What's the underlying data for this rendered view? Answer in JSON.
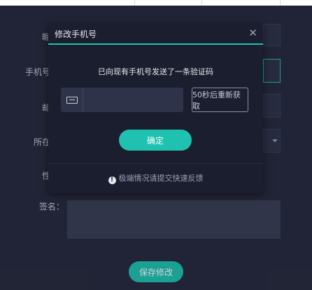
{
  "form": {
    "labels": {
      "nickname": "昵",
      "phone": "手机号",
      "email": "邮",
      "location": "所在",
      "gender": "性",
      "signature": "签名："
    },
    "save_label": "保存修改"
  },
  "modal": {
    "title": "修改手机号",
    "close_glyph": "✕",
    "message": "已向现有手机号发送了一条验证码",
    "code_value": "",
    "resend_label": "50秒后重新获取",
    "confirm_label": "确定",
    "warn_glyph": "!",
    "footer_note": "极端情况请提交快速反馈"
  },
  "colors": {
    "accent": "#1fc2b0",
    "background": "#262a3e",
    "modal": "#1b1e2e"
  }
}
